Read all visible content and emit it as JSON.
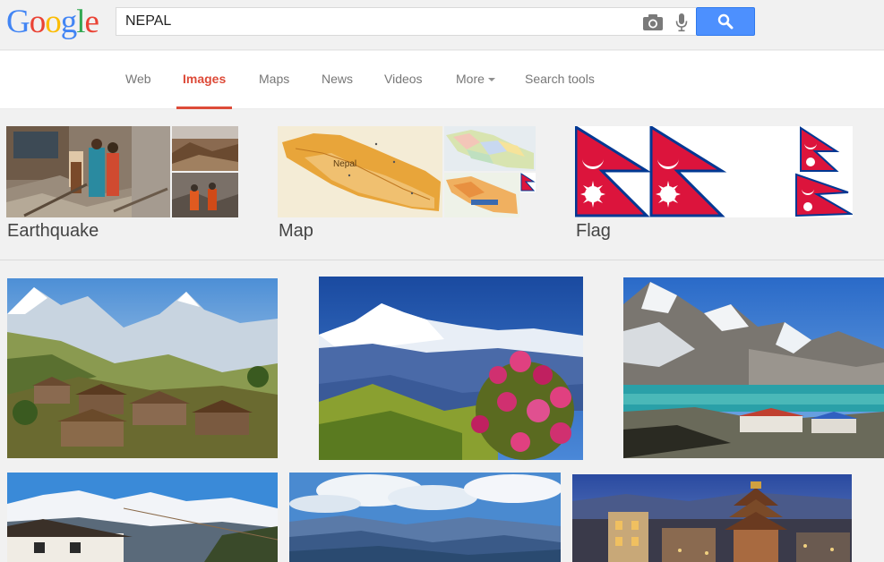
{
  "logo": {
    "letters": [
      {
        "ch": "G",
        "color": "#4285f4"
      },
      {
        "ch": "o",
        "color": "#ea4335"
      },
      {
        "ch": "o",
        "color": "#fbbc05"
      },
      {
        "ch": "g",
        "color": "#4285f4"
      },
      {
        "ch": "l",
        "color": "#34a853"
      },
      {
        "ch": "e",
        "color": "#ea4335"
      }
    ]
  },
  "search": {
    "query": "NEPAL"
  },
  "nav": {
    "tabs": [
      {
        "label": "Web",
        "active": false
      },
      {
        "label": "Images",
        "active": true
      },
      {
        "label": "Maps",
        "active": false
      },
      {
        "label": "News",
        "active": false
      },
      {
        "label": "Videos",
        "active": false
      },
      {
        "label": "More",
        "active": false
      },
      {
        "label": "Search tools",
        "active": false
      }
    ]
  },
  "related_searches": [
    {
      "label": "Earthquake"
    },
    {
      "label": "Map",
      "map_label": "Nepal"
    },
    {
      "label": "Flag"
    }
  ],
  "colors": {
    "accent_red": "#dd4b39",
    "search_blue": "#4d90fe",
    "flag_crimson": "#dc143c",
    "flag_blue": "#003893"
  }
}
